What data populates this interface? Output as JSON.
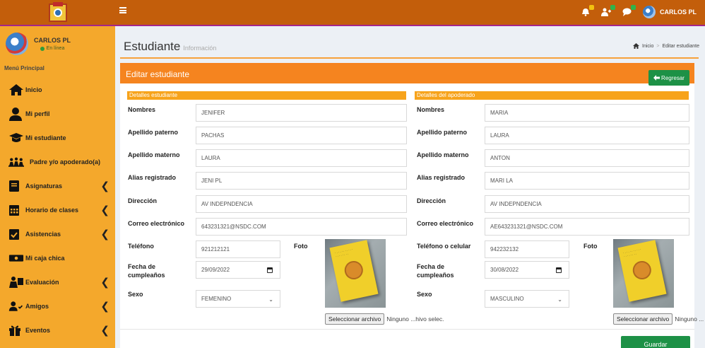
{
  "sidebar": {
    "user": {
      "name": "CARLOS PL",
      "status": "En línea"
    },
    "menu_header": "Menú Principal",
    "items": [
      {
        "label": "Inicio",
        "icon": "home-icon"
      },
      {
        "label": "Mi perfil",
        "icon": "user-icon"
      },
      {
        "label": "Mi estudiante",
        "icon": "graduation-cap-icon"
      },
      {
        "label": "Padre y/o apoderado(a)",
        "icon": "family-icon"
      },
      {
        "label": "Asignaturas",
        "icon": "book-icon",
        "expandable": true
      },
      {
        "label": "Horario de clases",
        "icon": "calendar-icon",
        "expandable": true
      },
      {
        "label": "Asistencias",
        "icon": "calendar-check-icon",
        "expandable": true
      },
      {
        "label": "Mi caja chica",
        "icon": "money-icon"
      },
      {
        "label": "Evaluación",
        "icon": "evaluation-icon",
        "expandable": true
      },
      {
        "label": "Amigos",
        "icon": "friends-icon",
        "expandable": true
      },
      {
        "label": "Eventos",
        "icon": "gift-icon",
        "expandable": true
      }
    ]
  },
  "topbar": {
    "user_name": "CARLOS PL",
    "colors": {
      "bar": "#c35e0b",
      "accent": "#a4268a"
    }
  },
  "page": {
    "title": "Estudiante",
    "subtitle": "Información",
    "breadcrumb": {
      "home": "Inicio",
      "current": "Editar estudiante"
    }
  },
  "form": {
    "title": "Editar estudiante",
    "back_label": "Regresar",
    "save_label": "Guardar",
    "student": {
      "section": "Detalles estudiante",
      "labels": {
        "nombres": "Nombres",
        "paterno": "Apellido paterno",
        "materno": "Apellido materno",
        "alias": "Alias registrado",
        "direccion": "Dirección",
        "correo": "Correo electrónico",
        "telefono": "Teléfono",
        "foto": "Foto",
        "fecha_1": "Fecha de",
        "fecha_2": "cumpleaños",
        "sexo": "Sexo"
      },
      "values": {
        "nombres": "JENIFER",
        "paterno": "PACHAS",
        "materno": "LAURA",
        "alias": "JENI PL",
        "direccion": "AV INDEPNDENCIA",
        "correo": "643231321@NSDC.COM",
        "telefono": "921212121",
        "fecha": "29/09/2022",
        "sexo": "FEMENINO"
      },
      "file_button": "Seleccionar archivo",
      "file_status": "Ninguno ...hivo selec."
    },
    "guardian": {
      "section": "Detalles del apoderado",
      "labels": {
        "nombres": "Nombres",
        "paterno": "Apellido paterno",
        "materno": "Apellido materno",
        "alias": "Alias registrado",
        "direccion": "Dirección",
        "correo": "Correo electrónico",
        "telefono": "Teléfono o celular",
        "foto": "Foto",
        "fecha_1": "Fecha de",
        "fecha_2": "cumpleaños",
        "sexo": "Sexo"
      },
      "values": {
        "nombres": "MARIA",
        "paterno": "LAURA",
        "materno": "ANTON",
        "alias": "MARI LA",
        "direccion": "AV INDEPNDENCIA",
        "correo": "AE643231321@NSDC.COM",
        "telefono": "942232132",
        "fecha": "30/08/2022",
        "sexo": "MASCULINO"
      },
      "file_button": "Seleccionar archivo",
      "file_status": "Ninguno ..."
    }
  }
}
